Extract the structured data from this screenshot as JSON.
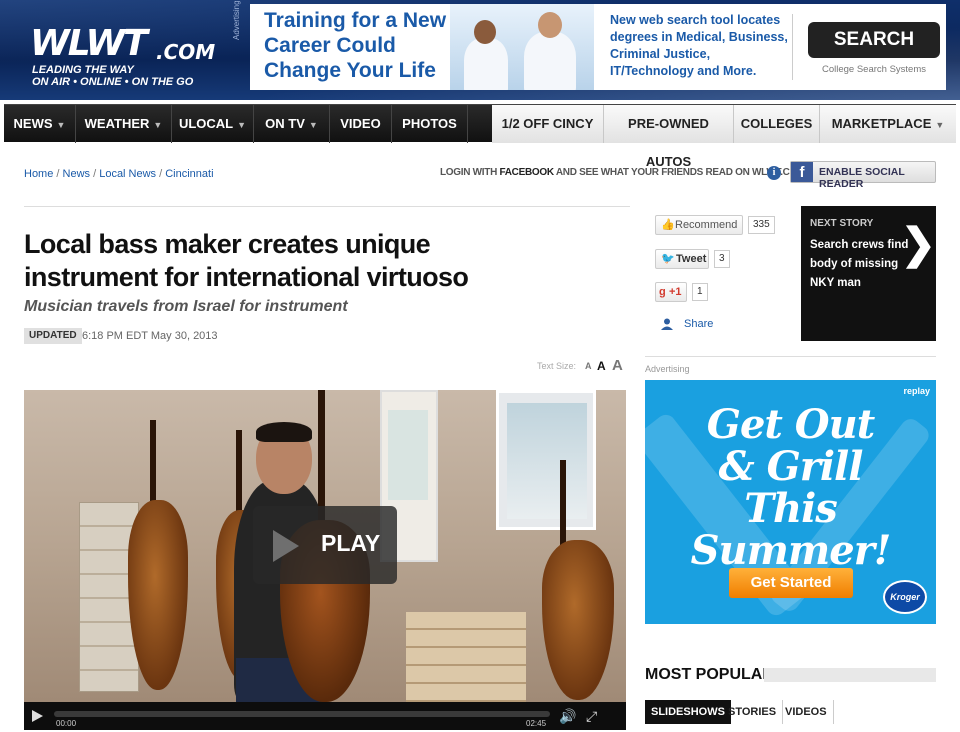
{
  "header": {
    "logo": "WLWT",
    "logo_suffix": ".COM",
    "tagline_1": "LEADING THE WAY",
    "tagline_2": "ON AIR • ONLINE • ON THE GO",
    "advertising_label": "Advertising"
  },
  "top_ad": {
    "headline": "Training for a New Career Could Change Your Life",
    "description": "New web search tool locates degrees in Medical, Business, Criminal Justice, IT/Technology and More.",
    "button": "SEARCH HERE",
    "sponsor": "College Search Systems"
  },
  "nav": {
    "left": [
      {
        "label": "NEWS",
        "dropdown": true
      },
      {
        "label": "WEATHER",
        "dropdown": true
      },
      {
        "label": "ULOCAL",
        "dropdown": true
      },
      {
        "label": "ON TV",
        "dropdown": true
      },
      {
        "label": "VIDEO",
        "dropdown": false
      },
      {
        "label": "PHOTOS",
        "dropdown": false
      }
    ],
    "right": [
      {
        "label": "1/2 OFF CINCY",
        "dropdown": false
      },
      {
        "label": "PRE-OWNED AUTOS",
        "dropdown": false
      },
      {
        "label": "COLLEGES",
        "dropdown": false
      },
      {
        "label": "MARKETPLACE",
        "dropdown": true
      }
    ]
  },
  "breadcrumb": [
    "Home",
    "News",
    "Local News",
    "Cincinnati"
  ],
  "social_login": {
    "prefix": "LOGIN WITH ",
    "brand": "FACEBOOK",
    "suffix": " AND SEE WHAT YOUR FRIENDS READ ON WLWT.COM",
    "button": "ENABLE SOCIAL READER"
  },
  "article": {
    "headline": "Local bass maker creates unique instrument for international virtuoso",
    "subhead": "Musician travels from Israel for instrument",
    "updated_label": "UPDATED",
    "updated_time": "6:18 PM EDT May 30, 2013",
    "text_size_label": "Text Size:"
  },
  "social": {
    "recommend_label": "Recommend",
    "recommend_count": "335",
    "tweet_label": "Tweet",
    "tweet_count": "3",
    "gplus_label": "+1",
    "gplus_count": "1",
    "share_label": "Share"
  },
  "next_story": {
    "label": "NEXT STORY",
    "title": "Search crews find body of missing NKY man"
  },
  "video": {
    "play_label": "PLAY",
    "time_current": "00:00",
    "time_total": "02:45",
    "progress": 0
  },
  "right_ad": {
    "label": "Advertising",
    "replay": "replay",
    "headline": "Get Out & Grill This Summer!",
    "button": "Get Started",
    "brand": "Kroger",
    "background": "#1aa0e0"
  },
  "most_popular": {
    "title": "MOST POPULAR",
    "tabs": [
      "SLIDESHOWS",
      "STORIES",
      "VIDEOS"
    ],
    "active_tab": "SLIDESHOWS"
  },
  "colors": {
    "link": "#1a5aa8",
    "nav_dark": "#111111",
    "header_bg": "#0a2457",
    "facebook": "#3b5998"
  }
}
